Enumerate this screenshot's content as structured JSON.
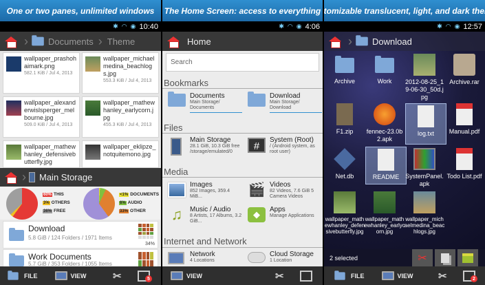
{
  "panels": [
    {
      "banner": "One or two panes, unlimited windows",
      "time": "10:40"
    },
    {
      "banner": "The Home Screen: access to everything",
      "time": "4:06"
    },
    {
      "banner": "Customizable translucent, light, and dark themes",
      "time": "12:57"
    }
  ],
  "p1": {
    "crumbs": [
      "Documents",
      "Theme"
    ],
    "tiles": [
      {
        "name": "wallpaper_prashohaimark.png",
        "meta": "582.1 KiB / Jul 4, 2013"
      },
      {
        "name": "wallpaper_michaelmedina_beachlogs.jpg",
        "meta": "553.3 KiB / Jul 4, 2013"
      },
      {
        "name": "wallpaper_alexanderwislsperger_melbourne.jpg",
        "meta": "509.0 KiB / Jul 4, 2013"
      },
      {
        "name": "wallpaper_mathewhanley_earlycorn.jpg",
        "meta": "455.3 KiB / Jul 4, 2013"
      },
      {
        "name": "wallpaper_mathewhanley_defensivebutterfly.jpg",
        "meta": ""
      },
      {
        "name": "wallpaper_eklipze_notquitemono.jpg",
        "meta": ""
      }
    ],
    "storage_title": "Main Storage",
    "legend_left": [
      {
        "pct": "60%",
        "label": "THIS",
        "color": "#e53935"
      },
      {
        "pct": "3%",
        "label": "OTHERS",
        "color": "#f0c020"
      },
      {
        "pct": "36%",
        "label": "FREE",
        "color": "#999999"
      }
    ],
    "legend_right": [
      {
        "pct": "<1%",
        "label": "DOCUMENTS",
        "color": "#e8e030"
      },
      {
        "pct": "6%",
        "label": "AUDIO",
        "color": "#80c040"
      },
      {
        "pct": "33%",
        "label": "OTHER",
        "color": "#e08030"
      }
    ],
    "folders": [
      {
        "name": "Download",
        "info": "5.8 GiB / 124 Folders / 1971 Items",
        "pct": "34%"
      },
      {
        "name": "Work Documents",
        "info": "5.7 GiB / 353 Folders / 1055 Items",
        "pct": ""
      }
    ],
    "bottom": {
      "file": "FILE",
      "view": "VIEW",
      "badge": "5"
    }
  },
  "p2": {
    "crumb": "Home",
    "search_placeholder": "Search",
    "sections": [
      "Bookmarks",
      "Files",
      "Media",
      "Internet and Network"
    ],
    "items": [
      {
        "title": "Documents",
        "sub": "Main Storage/ Documents"
      },
      {
        "title": "Download",
        "sub": "Main Storage/ Download"
      },
      {
        "title": "Main Storage",
        "sub": "28.1 GiB, 10.3 GiB free /storage/emulated/0"
      },
      {
        "title": "System (Root)",
        "sub": "/ (Android system, as root user)"
      },
      {
        "title": "Images",
        "sub": "852 Images, 359.4 MiB..."
      },
      {
        "title": "Videos",
        "sub": "82 Videos, 7.6 GiB 5 Camera Videos"
      },
      {
        "title": "Music / Audio",
        "sub": "8 Artists, 17 Albums, 3.2 GiB..."
      },
      {
        "title": "Apps",
        "sub": "Manage Applications"
      },
      {
        "title": "Network",
        "sub": "4 Locations"
      },
      {
        "title": "Cloud Storage",
        "sub": "1 Location"
      }
    ],
    "bottom": {
      "view": "VIEW"
    }
  },
  "p3": {
    "crumb": "Download",
    "files": [
      "Archive",
      "Work",
      "2012-08-25_19-06-30_50d.jpg",
      "Archive.rar",
      "F1.zip",
      "fennec-23.0b2.apk",
      "log.txt",
      "Manual.pdf",
      "Net.db",
      "README",
      "SystemPanel.apk",
      "Todo List.pdf",
      "wallpaper_mathewhanley_defensivebutterfly.jpg",
      "wallpaper_mathewhanley_earlycorn.jpg",
      "wallpaper_michaelmedina_beachlogs.jpg"
    ],
    "selected_text": "2 selected",
    "bottom": {
      "file": "FILE",
      "view": "VIEW",
      "badge": "2"
    }
  }
}
